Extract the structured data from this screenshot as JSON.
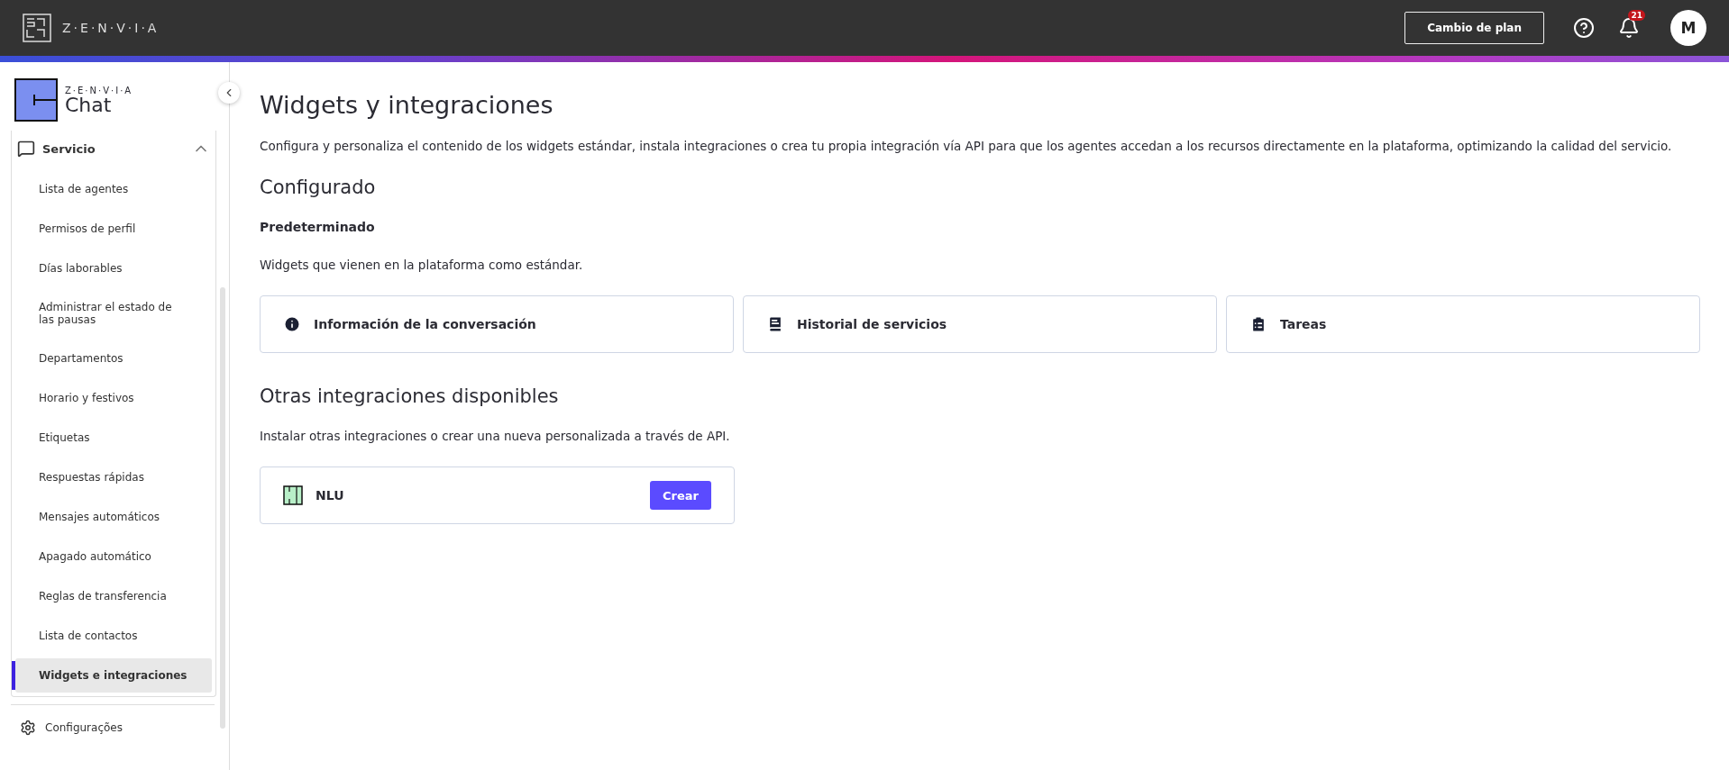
{
  "topbar": {
    "brand": "Z·E·N·V·I·A",
    "plan_button": "Cambio de plan",
    "notifications": "21",
    "avatar": "M"
  },
  "sidebar": {
    "product_brand": "Z·E·N·V·I·A",
    "product_name": "Chat",
    "section": {
      "label": "Servicio",
      "expanded": true,
      "items": [
        {
          "label": "Lista de agentes",
          "selected": false
        },
        {
          "label": "Permisos de perfil",
          "selected": false
        },
        {
          "label": "Días laborables",
          "selected": false
        },
        {
          "label": "Administrar el estado de las pausas",
          "selected": false
        },
        {
          "label": "Departamentos",
          "selected": false
        },
        {
          "label": "Horario y festivos",
          "selected": false
        },
        {
          "label": "Etiquetas",
          "selected": false
        },
        {
          "label": "Respuestas rápidas",
          "selected": false
        },
        {
          "label": "Mensajes automáticos",
          "selected": false
        },
        {
          "label": "Apagado automático",
          "selected": false
        },
        {
          "label": "Reglas de transferencia",
          "selected": false
        },
        {
          "label": "Lista de contactos",
          "selected": false
        },
        {
          "label": "Widgets e integraciones",
          "selected": true
        }
      ]
    },
    "footer_item": "Configurações"
  },
  "main": {
    "title": "Widgets y integraciones",
    "description": "Configura y personaliza el contenido de los widgets estándar, instala integraciones o crea tu propia integración vía API para que los agentes accedan a los recursos directamente en la plataforma, optimizando la calidad del servicio.",
    "configured": {
      "heading": "Configurado",
      "subheading": "Predeterminado",
      "description": "Widgets que vienen en la plataforma como estándar.",
      "widgets": [
        {
          "kind": "info",
          "label": "Información de la conversación"
        },
        {
          "kind": "book",
          "label": "Historial de servicios"
        },
        {
          "kind": "tasks",
          "label": "Tareas"
        }
      ]
    },
    "others": {
      "heading": "Otras integraciones disponibles",
      "description": "Instalar otras integraciones o crear una nueva personalizada a través de API.",
      "integrations": [
        {
          "label": "NLU",
          "button": "Crear"
        }
      ]
    }
  }
}
